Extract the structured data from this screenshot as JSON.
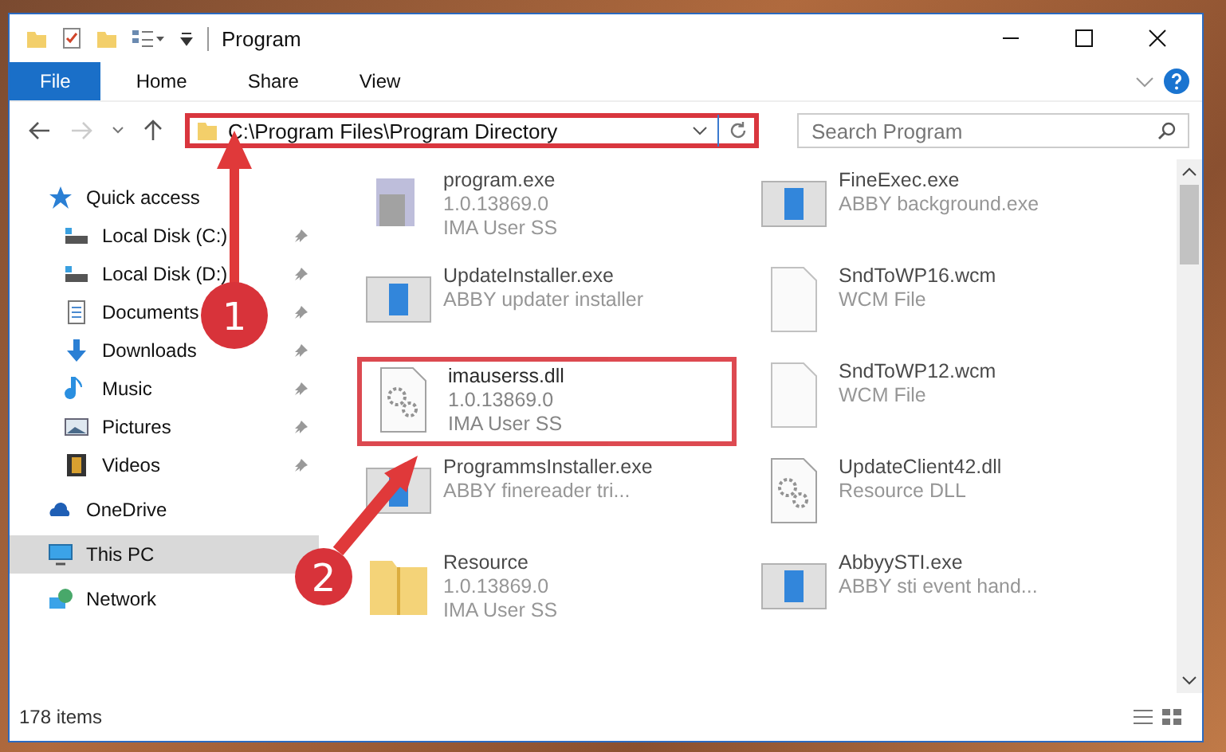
{
  "window": {
    "title": "Program"
  },
  "ribbon_tabs": [
    {
      "label": "File",
      "selected": true
    },
    {
      "label": "Home",
      "selected": false
    },
    {
      "label": "Share",
      "selected": false
    },
    {
      "label": "View",
      "selected": false
    }
  ],
  "address": {
    "path": "C:\\Program Files\\Program Directory",
    "highlighted": true
  },
  "search": {
    "placeholder": "Search Program"
  },
  "navigation": [
    {
      "label": "Quick access",
      "kind": "star",
      "selected": false,
      "children": [
        {
          "label": "Local Disk (C:)",
          "kind": "disk",
          "pinned": true,
          "selected": false
        },
        {
          "label": "Local Disk (D:)",
          "kind": "disk",
          "pinned": true,
          "selected": false
        },
        {
          "label": "Documents",
          "kind": "doc",
          "pinned": true,
          "selected": false
        },
        {
          "label": "Downloads",
          "kind": "down",
          "pinned": true,
          "selected": false
        },
        {
          "label": "Music",
          "kind": "music",
          "pinned": true,
          "selected": false
        },
        {
          "label": "Pictures",
          "kind": "pic",
          "pinned": true,
          "selected": false
        },
        {
          "label": "Videos",
          "kind": "video",
          "pinned": true,
          "selected": false
        }
      ]
    },
    {
      "label": "OneDrive",
      "kind": "cloud",
      "selected": false
    },
    {
      "label": "This PC",
      "kind": "pc",
      "selected": true
    },
    {
      "label": "Network",
      "kind": "net",
      "selected": false
    }
  ],
  "files": [
    {
      "name": "program.exe",
      "lines": [
        "1.0.13869.0",
        "IMA User SS"
      ],
      "kind": "installer",
      "highlighted": false
    },
    {
      "name": "FineExec.exe",
      "lines": [
        "ABBY background.exe"
      ],
      "kind": "app",
      "highlighted": false
    },
    {
      "name": "UpdateInstaller.exe",
      "lines": [
        "ABBY updater installer"
      ],
      "kind": "app",
      "highlighted": false
    },
    {
      "name": "SndToWP16.wcm",
      "lines": [
        "WCM File"
      ],
      "kind": "file",
      "highlighted": false
    },
    {
      "name": "imauserss.dll",
      "lines": [
        "1.0.13869.0",
        "IMA User SS"
      ],
      "kind": "dll",
      "highlighted": true
    },
    {
      "name": "SndToWP12.wcm",
      "lines": [
        "WCM File"
      ],
      "kind": "file",
      "highlighted": false
    },
    {
      "name": "ProgrammsInstaller.exe",
      "lines": [
        "ABBY finereader tri..."
      ],
      "kind": "app",
      "highlighted": false
    },
    {
      "name": "UpdateClient42.dll",
      "lines": [
        "Resource DLL"
      ],
      "kind": "dll",
      "highlighted": false
    },
    {
      "name": "Resource",
      "lines": [
        "1.0.13869.0",
        "IMA User SS"
      ],
      "kind": "folder",
      "highlighted": false
    },
    {
      "name": "AbbyySTI.exe",
      "lines": [
        "ABBY sti event hand..."
      ],
      "kind": "app",
      "highlighted": false
    }
  ],
  "callouts": [
    {
      "number": "1"
    },
    {
      "number": "2"
    }
  ],
  "status_bar": {
    "item_count": "178 items"
  }
}
